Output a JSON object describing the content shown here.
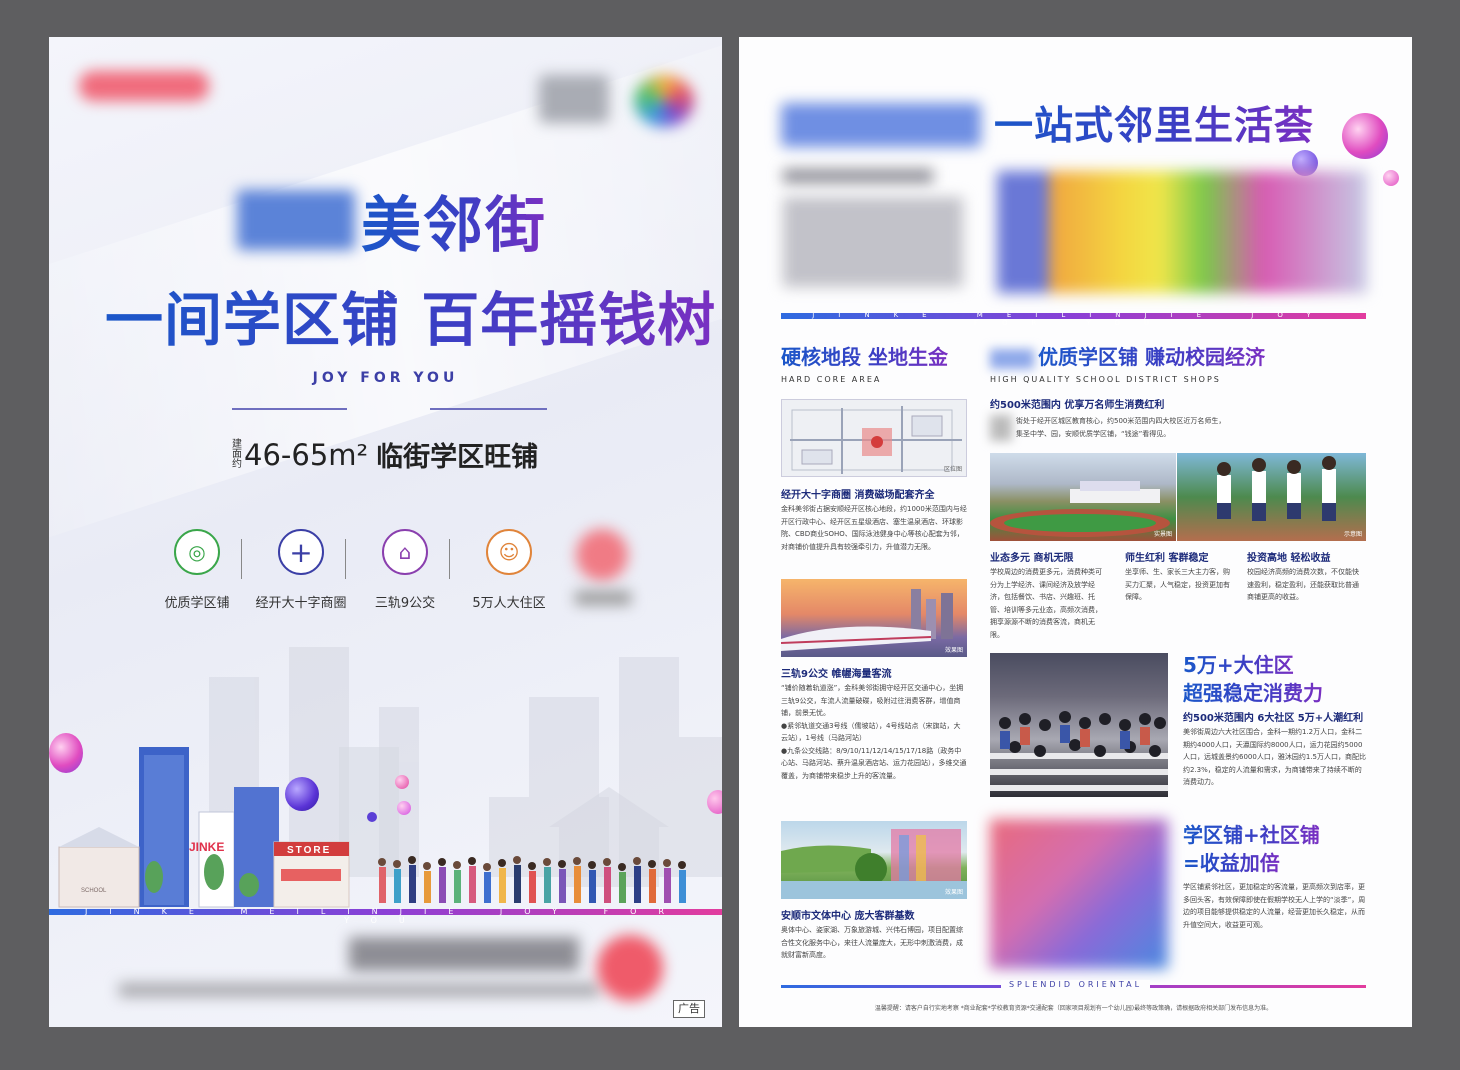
{
  "left_page": {
    "title_suffix": "美邻街",
    "headline": "一间学区铺 百年摇钱树",
    "tagline": "JOY FOR YOU",
    "area_prefix": "建面约",
    "area_range": "46-65m²",
    "area_desc": "临街学区旺铺",
    "features": [
      {
        "label": "优质学区铺",
        "icon": "school-shop-icon",
        "color": "#3aa64a",
        "glyph": "◎"
      },
      {
        "label": "经开大十字商圈",
        "icon": "crosshair-icon",
        "color": "#3b3fa6",
        "glyph": "+"
      },
      {
        "label": "三轨9公交",
        "icon": "metro-icon",
        "color": "#8a3fae",
        "glyph": "⌂"
      },
      {
        "label": "5万人大住区",
        "icon": "people-icon",
        "color": "#e0843a",
        "glyph": "☺"
      }
    ],
    "store_sign": "STORE",
    "building_sign": "JINKE",
    "school_sign": "SCHOOL",
    "stripe_text": "JINKE MEILINJIE JOY FOR YOU",
    "ad_tag": "广告"
  },
  "right_page": {
    "title": "一站式邻里生活荟",
    "stripe_text": "JINKE MEILINJIE JOY FOR YOU",
    "section1": {
      "title": "硬核地段 坐地生金",
      "subtitle": "HARD CORE AREA",
      "caption1": "经开大十字商圈 消费磁场配套齐全",
      "body1": "金科美邻街占据安顺经开区核心地段，约1000米范围内与经开区行政中心、经开区五星级酒店、塞生温泉酒店、环球影院、CBD商业SOHO、国际泳池健身中心等核心配套为邻，对商铺价值提升具有较强牵引力，升值潜力无限。",
      "map_tag": "区位图",
      "train_tag": "效果图",
      "caption2": "三轨9公交 帷幄海量客流",
      "body2": "“铺价随着轨道涨”，金科美邻街拥守经开区交通中心，坐拥三轨9公交，车流人流量破碟，吸附过往消费客群，增值商铺，前景无忧。\n●紧邻轨道交通3号线（儒坡站），4号线站点（宋旗站，大云站），1号线（马路河站）\n●九条公交线路：8/9/10/11/12/14/15/17/18路（政务中心站、马路河站、蔡升温泉酒店站、运力花园站），多维交通覆盖，为商铺带来稳步上升的客流量。",
      "caption3": "安顺市文体中心 庞大客群基数",
      "park_tag": "效果图",
      "body3": "奥体中心、姿家湖、万象旅游城、兴伟石博园，项目配置综合性文化服务中心，来往人流量庞大，无形中刺激消费，成就财富新高度。"
    },
    "section2": {
      "title": "优质学区铺 赚动校园经济",
      "subtitle": "HIGH QUALITY SCHOOL DISTRICT SHOPS",
      "lead": "约500米范围内 优享万名师生消费红利",
      "body": "街处于经开区城区教育核心，约500米范围内四大校区近万名师生，集圣中学、园，安顺优质学区铺，“钱途”看得见。",
      "stadium_tag": "实景图",
      "kids_tag": "示意图",
      "col1_title": "业态多元 商机无限",
      "col1_body": "学校周边的消费更多元，消费种类可分为上学经济、课间经济及放学经济，包括餐饮、书店、兴趣班、托管、培训等多元业态，高频次消费，拥享源源不断的消费客流，商机无限。",
      "col2_title": "师生红利 客群稳定",
      "col2_body": "坐享师、生、家长三大主力客，购买力汇聚，人气稳定，投资更加有保障。",
      "col3_title": "投资高地 轻松收益",
      "col3_body": "校园经济高频的消费次数，不仅能快速盈利，稳定盈利，还能获取比普通商铺更高的收益。"
    },
    "section3": {
      "title_line1": "5万+大住区",
      "title_line2": "超强稳定消费力",
      "lead": "约500米范围内 6大社区 5万+人潮红利",
      "body": "美邻街周边六大社区围合，金科一期约1.2万人口，金科二期约4000人口，天瀛国际约8000人口，运力花园约5000人口，远城盖景约6000人口，雅沐园约1.5万人口，商配比约2.3%，稳定的人流量和需求，为商铺带来了持续不断的消费动力。"
    },
    "section4": {
      "title_line1": "学区铺+社区铺",
      "title_line2": "=收益加倍",
      "body": "学区铺紧邻社区，更加稳定的客流量，更高频次到店率，更多回头客，有效保障即使在假期学校无人上学的“淡季”，周边的项目能够提供稳定的人流量，经营更加长久稳定，从而升值空间大，收益更可观。"
    },
    "footer_label": "SPLENDID ORIENTAL",
    "disclaimer": "温馨提醒：请客户自行实地考察 *商业配套*学校教育资源*交通配套（回家项目规划有一个幼儿园)最终等政策确，请根据政府相关部门发布信息为准。"
  }
}
